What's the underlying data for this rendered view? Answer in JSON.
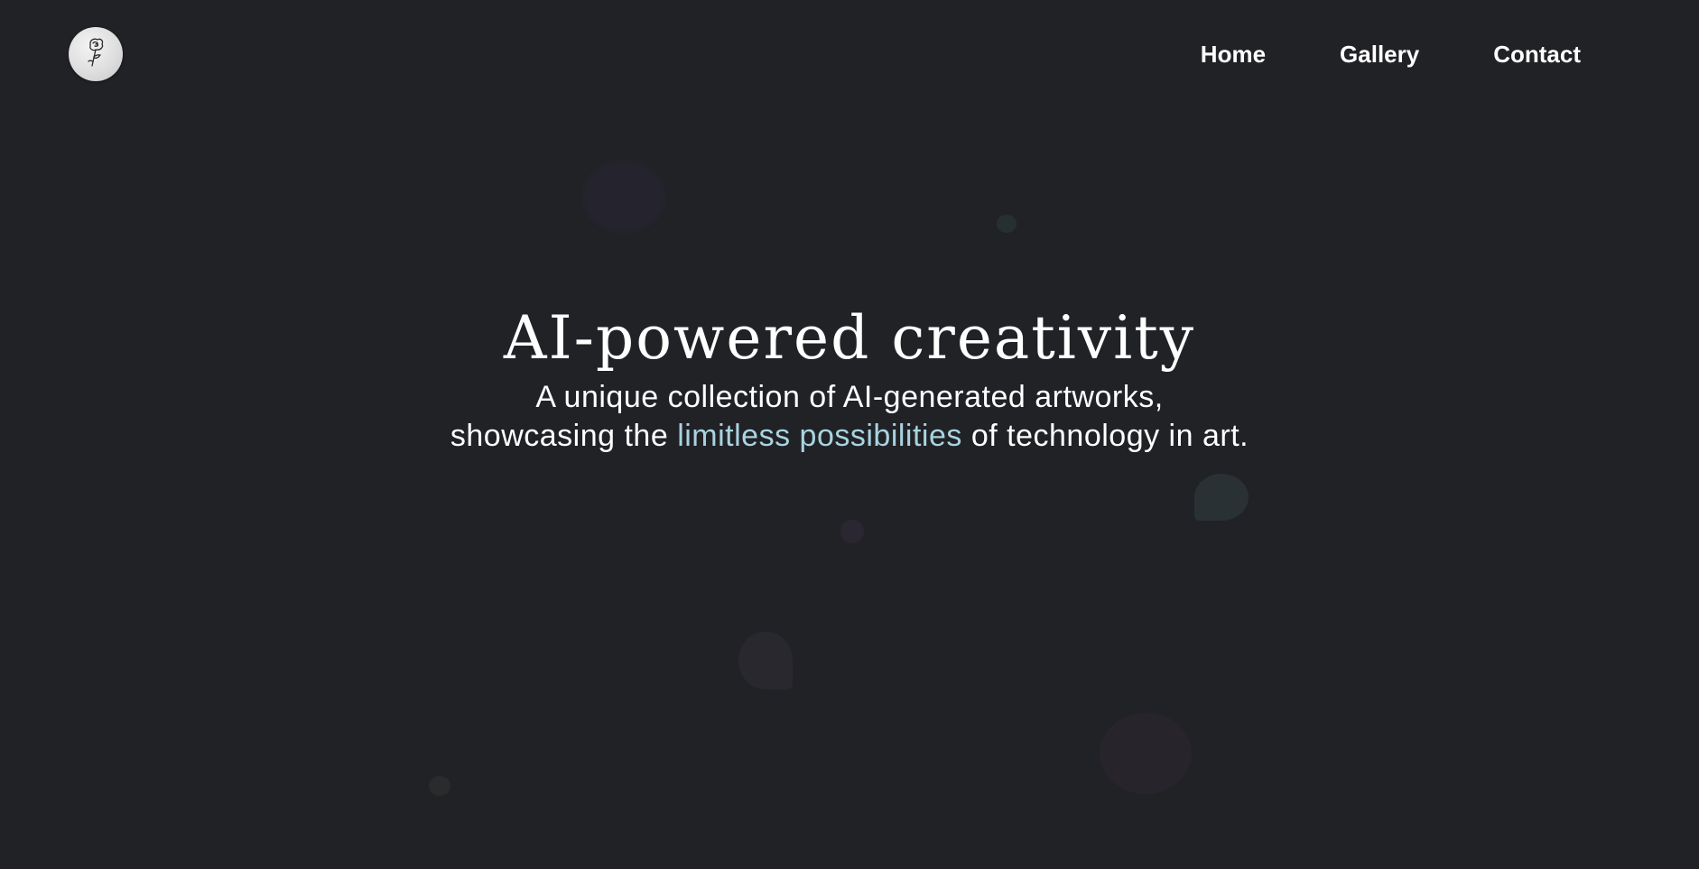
{
  "header": {
    "logo_icon": "rose-icon",
    "nav": [
      {
        "label": "Home"
      },
      {
        "label": "Gallery"
      },
      {
        "label": "Contact"
      }
    ]
  },
  "hero": {
    "title": "AI-powered creativity",
    "subtitle_line1": "A unique collection of AI-generated artworks,",
    "subtitle_line2_before": "showcasing the ",
    "subtitle_line2_accent": "limitless possibilities",
    "subtitle_line2_after": " of technology in art."
  },
  "colors": {
    "background": "#212226",
    "text": "#ffffff",
    "accent": "#a9d3e0"
  }
}
